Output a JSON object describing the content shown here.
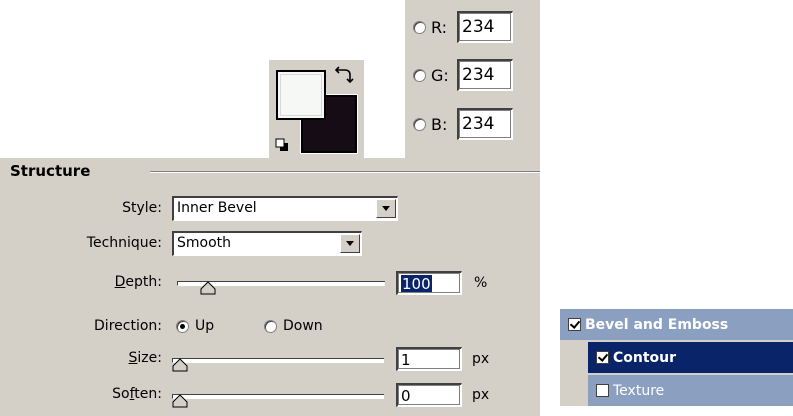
{
  "rgb": {
    "r": {
      "label": "R:",
      "value": "234"
    },
    "g": {
      "label": "G:",
      "value": "234"
    },
    "b": {
      "label": "B:",
      "value": "234"
    }
  },
  "swatches": {
    "foreground_color": "#f6f8f6",
    "background_color": "#150c15",
    "icons": [
      "swap-colors-icon",
      "default-colors-icon"
    ]
  },
  "structure": {
    "title": "Structure",
    "style": {
      "label": "Style:",
      "value": "Inner Bevel"
    },
    "technique": {
      "label": "Technique:",
      "value": "Smooth"
    },
    "depth": {
      "label_pre": "",
      "label_u": "D",
      "label_post": "epth:",
      "value": "100",
      "unit": "%",
      "slider_fraction": 0.12
    },
    "direction": {
      "label": "Direction:",
      "options": [
        "Up",
        "Down"
      ],
      "selected": "Up"
    },
    "size": {
      "label_u": "S",
      "label_post": "ize:",
      "value": "1",
      "unit": "px",
      "slider_fraction": 0.0
    },
    "soften": {
      "label_pre": "So",
      "label_u": "f",
      "label_post": "ten:",
      "value": "0",
      "unit": "px",
      "slider_fraction": 0.0
    }
  },
  "layer_styles": {
    "items": [
      {
        "label": "Bevel and Emboss",
        "checked": true
      },
      {
        "label": "Contour",
        "checked": true
      },
      {
        "label": "Texture",
        "checked": false
      }
    ]
  },
  "colors": {
    "panel": "#d4d0c8",
    "selection": "#0a246a",
    "list_inactive": "#8ba0c0"
  }
}
